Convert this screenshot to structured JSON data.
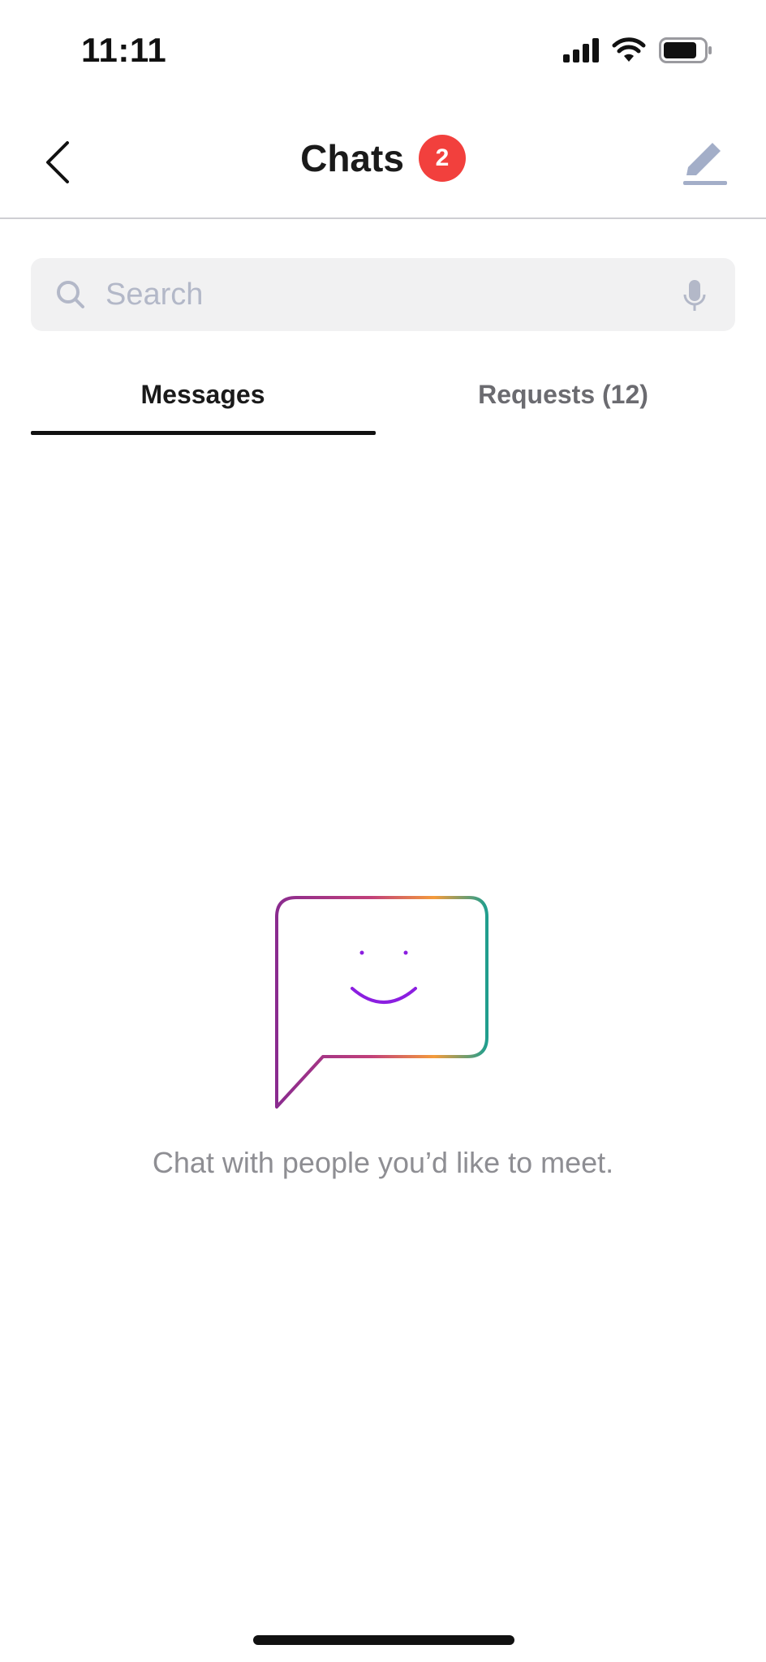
{
  "status_bar": {
    "time": "11:11"
  },
  "header": {
    "back_label": "back",
    "title": "Chats",
    "badge_count": "2"
  },
  "search": {
    "placeholder": "Search",
    "value": ""
  },
  "tabs": [
    {
      "label": "Messages",
      "active": true
    },
    {
      "label": "Requests (12)",
      "active": false
    }
  ],
  "empty_state": {
    "message": "Chat with people you’d like to meet."
  },
  "colors": {
    "badge": "#f2403d",
    "search_bg": "#f1f1f2",
    "placeholder": "#b3b8c8",
    "compose_icon": "#a3aec8",
    "gradient_purple": "#8a2b8f",
    "gradient_orange": "#f49b3b",
    "gradient_teal": "#1f9e8e",
    "smile": "#8b1ee0"
  },
  "icons": [
    "back-chevron-icon",
    "compose-icon",
    "search-icon",
    "mic-icon",
    "signal-icon",
    "wifi-icon",
    "battery-icon",
    "chat-bubble-smile-icon"
  ]
}
